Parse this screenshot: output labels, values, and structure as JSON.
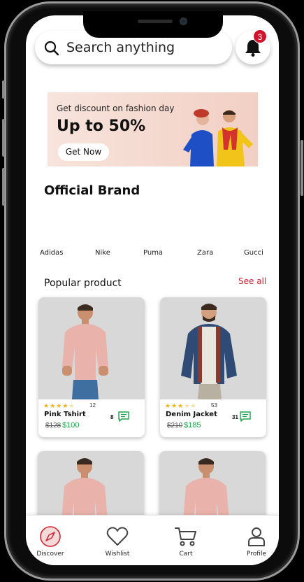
{
  "search": {
    "placeholder": "Search anything"
  },
  "notifications": {
    "count": "3"
  },
  "banner": {
    "subtitle": "Get discount on fashion day",
    "headline": "Up to 50%",
    "cta": "Get Now"
  },
  "brands_section": {
    "title": "Official Brand",
    "items": [
      "Adidas",
      "Nike",
      "Puma",
      "Zara",
      "Gucci"
    ]
  },
  "popular": {
    "title": "Popular product",
    "see_all": "See all"
  },
  "products": [
    {
      "name": "Pink Tshirt",
      "old_price": "$128",
      "price": "$100",
      "rating": 4,
      "reviews": "12",
      "comments": "8"
    },
    {
      "name": "Denim Jacket",
      "old_price": "$210",
      "price": "$185",
      "rating": 3,
      "reviews": "53",
      "comments": "31"
    }
  ],
  "nav": [
    {
      "label": "Discover",
      "icon": "compass-icon",
      "active": true
    },
    {
      "label": "Wishlist",
      "icon": "heart-icon"
    },
    {
      "label": "Cart",
      "icon": "cart-icon"
    },
    {
      "label": "Profile",
      "icon": "user-icon"
    }
  ],
  "colors": {
    "accent_red": "#d3232f",
    "price_green": "#1fa34a",
    "star": "#f2b51b",
    "card_bg": "#d8d8d8"
  }
}
